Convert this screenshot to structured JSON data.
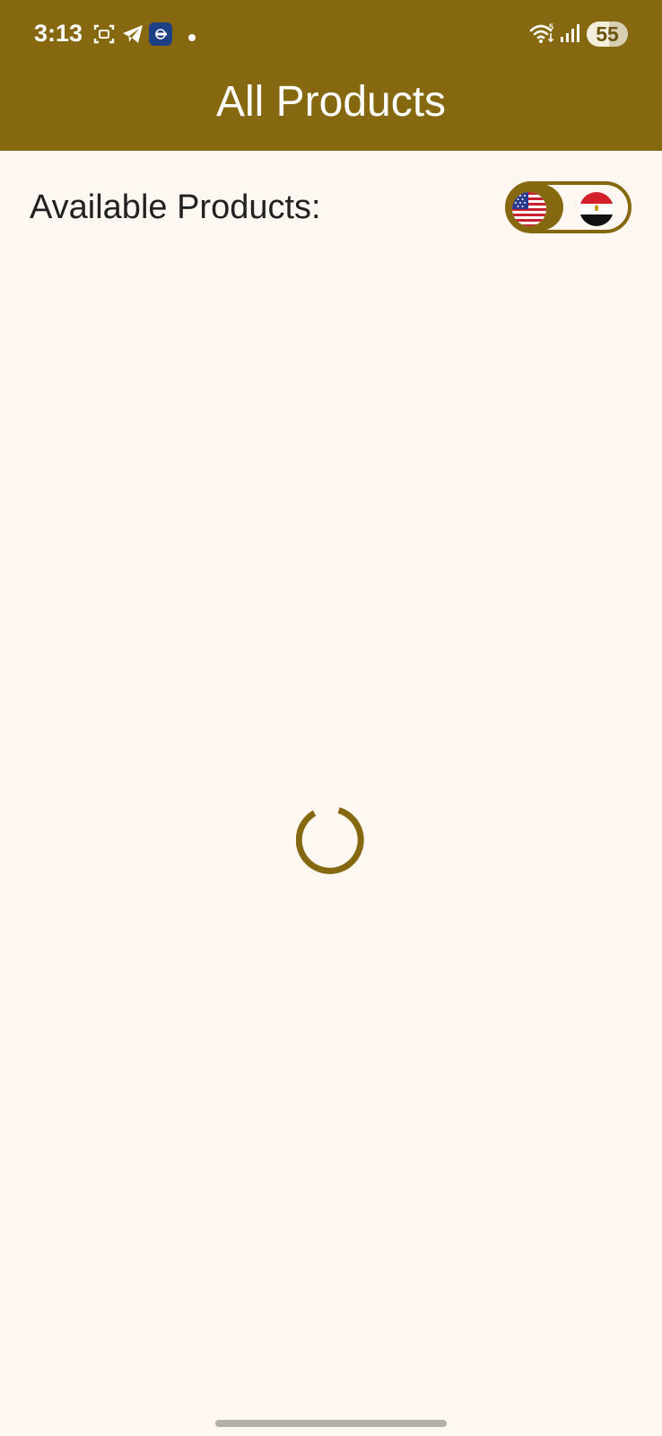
{
  "status_bar": {
    "time": "3:13",
    "battery_level": "55",
    "battery_fraction": 0.55,
    "icons": [
      "screenshot-icon",
      "telegram-icon",
      "app-notification-icon",
      "notification-dot-icon",
      "wifi-icon",
      "signal-icon",
      "battery-icon"
    ]
  },
  "header": {
    "title": "All Products"
  },
  "main": {
    "section_label": "Available Products:",
    "currency_toggle": {
      "options": [
        "us-flag-icon",
        "egypt-flag-icon"
      ],
      "selected": "us-flag-icon"
    },
    "loading": true
  },
  "colors": {
    "accent": "#856810",
    "background": "#FFF8F2",
    "header_text": "#FFFFFF"
  }
}
